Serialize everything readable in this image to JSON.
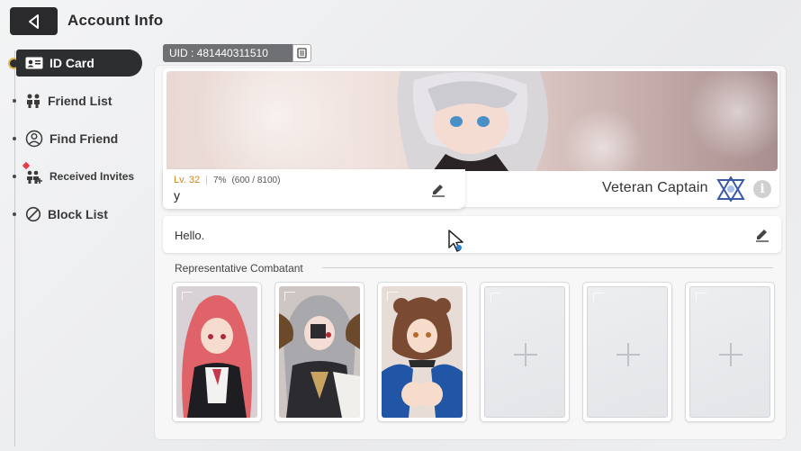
{
  "header": {
    "title": "Account Info"
  },
  "sidebar": {
    "items": [
      {
        "label": "ID Card",
        "icon": "id-card-icon",
        "active": true
      },
      {
        "label": "Friend List",
        "icon": "friends-icon",
        "active": false
      },
      {
        "label": "Find Friend",
        "icon": "find-friend-icon",
        "active": false
      },
      {
        "label": "Received Invites",
        "icon": "invites-icon",
        "active": false,
        "alert": true
      },
      {
        "label": "Block List",
        "icon": "block-icon",
        "active": false
      }
    ]
  },
  "profile": {
    "uid": "UID : 481440311510",
    "level": "Lv. 32",
    "exp_percent": "7%",
    "exp_detail": "(600 / 8100)",
    "exp_fraction": 0.07,
    "username": "y",
    "title": "Veteran Captain",
    "bio": "Hello."
  },
  "representative": {
    "label": "Representative Combatant",
    "slots": [
      {
        "filled": true,
        "hair": "#e0636a",
        "outfit": "#1e1e22"
      },
      {
        "filled": true,
        "hair": "#a9a9ad",
        "outfit": "#2b2b30"
      },
      {
        "filled": true,
        "hair": "#7a4b32",
        "outfit": "#2156a6"
      },
      {
        "filled": false
      },
      {
        "filled": false
      },
      {
        "filled": false
      }
    ]
  },
  "colors": {
    "accent_dark": "#2d2e30",
    "level_gold": "#d18a22",
    "alert_red": "#e33b4a",
    "emblem_blue": "#3a5aa8"
  }
}
